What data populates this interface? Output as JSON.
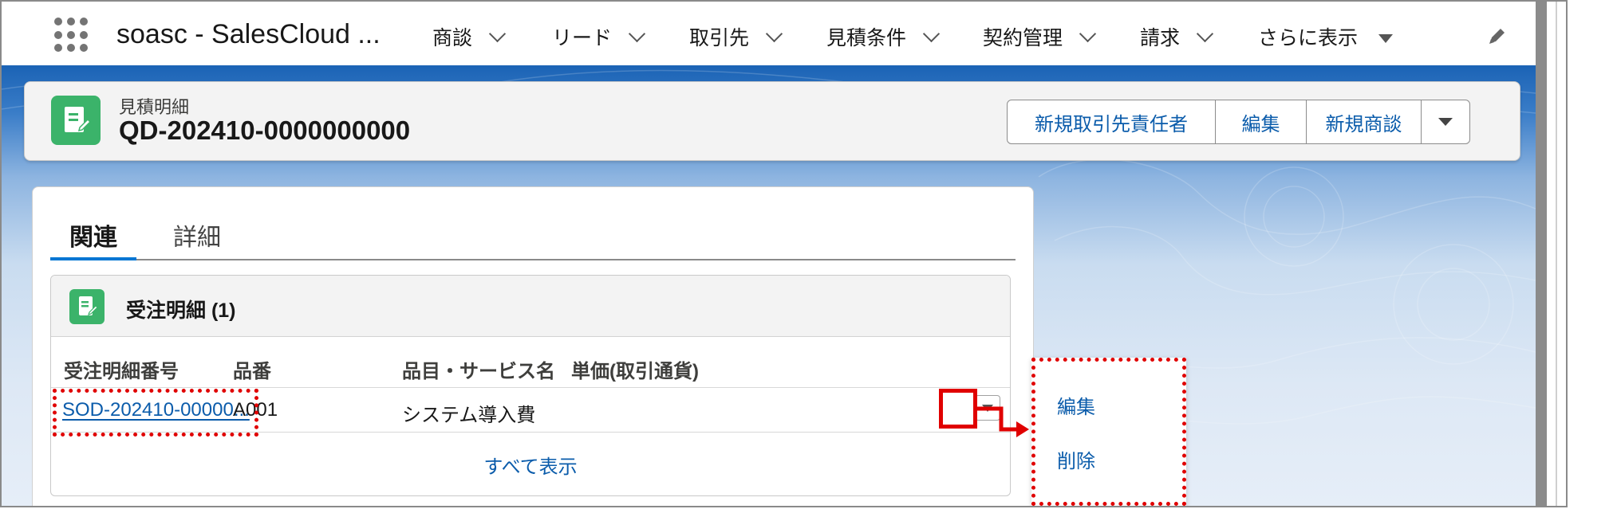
{
  "nav": {
    "app_name": "soasc - SalesCloud ...",
    "items": [
      {
        "label": "商談",
        "marker": "chevron"
      },
      {
        "label": "リード",
        "marker": "chevron"
      },
      {
        "label": "取引先",
        "marker": "chevron"
      },
      {
        "label": "見積条件",
        "marker": "chevron"
      },
      {
        "label": "契約管理",
        "marker": "chevron"
      },
      {
        "label": "請求",
        "marker": "chevron"
      },
      {
        "label": "さらに表示",
        "marker": "caret"
      }
    ],
    "icons": {
      "launcher": "app-launcher-icon",
      "edit": "pencil-icon"
    }
  },
  "record": {
    "object_label": "見積明細",
    "name": "QD-202410-0000000000",
    "actions": [
      "新規取引先責任者",
      "編集",
      "新規商談"
    ],
    "icon": "document-icon",
    "icon_color": "#3bb36a"
  },
  "tabs": [
    "関連",
    "詳細"
  ],
  "related_list": {
    "title": "受注明細 (1)",
    "columns": [
      "受注明細番号",
      "品番",
      "品目・サービス名",
      "単価(取引通貨)"
    ],
    "rows": [
      {
        "number": "SOD-202410-00000...",
        "product_code": "A001",
        "product_name": "システム導入費",
        "unit_price": ""
      }
    ],
    "view_all": "すべて表示"
  },
  "row_menu": {
    "items": [
      "編集",
      "削除"
    ]
  },
  "colors": {
    "link": "#0b5cab",
    "highlight": "#e00000",
    "brand_bg": "#1b63b5"
  }
}
